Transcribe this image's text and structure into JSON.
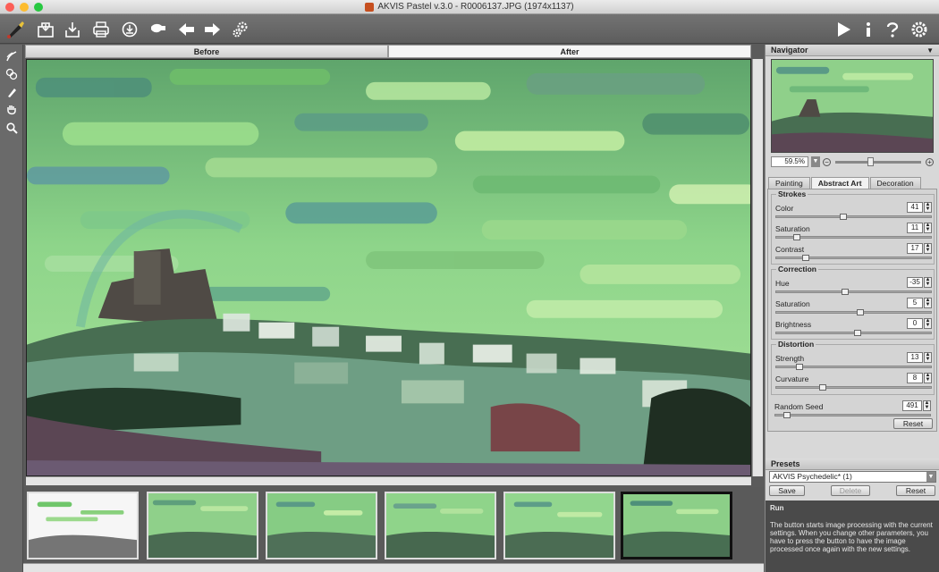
{
  "window": {
    "title": "AKVIS Pastel v.3.0 - R0006137.JPG (1974x1137)"
  },
  "toolbar": {
    "left_icons": [
      "brush-logo-icon",
      "open-icon",
      "save-icon",
      "print-icon",
      "share-icon",
      "plugin-icon",
      "undo-icon",
      "redo-icon",
      "gear-cogs-icon"
    ],
    "right_icons": [
      "run-icon",
      "info-icon",
      "help-icon",
      "settings-icon"
    ]
  },
  "view_tabs": {
    "before": "Before",
    "after": "After"
  },
  "navigator": {
    "title": "Navigator",
    "zoom": "59.5%"
  },
  "settings_tabs": [
    "Painting",
    "Abstract Art",
    "Decoration"
  ],
  "strokes": {
    "title": "Strokes",
    "params": [
      {
        "label": "Color",
        "value": "41",
        "level": 0.41
      },
      {
        "label": "Saturation",
        "value": "11",
        "level": 0.11
      },
      {
        "label": "Contrast",
        "value": "17",
        "level": 0.17
      }
    ]
  },
  "correction": {
    "title": "Correction",
    "params": [
      {
        "label": "Hue",
        "value": "-35",
        "level": 0.42
      },
      {
        "label": "Saturation",
        "value": "5",
        "level": 0.52
      },
      {
        "label": "Brightness",
        "value": "0",
        "level": 0.5
      }
    ]
  },
  "distortion": {
    "title": "Distortion",
    "params": [
      {
        "label": "Strength",
        "value": "13",
        "level": 0.13
      },
      {
        "label": "Curvature",
        "value": "8",
        "level": 0.28
      }
    ]
  },
  "random_seed": {
    "label": "Random Seed",
    "value": "491",
    "level": 0.05
  },
  "buttons": {
    "reset": "Reset",
    "save": "Save",
    "delete": "Delete",
    "preset_reset": "Reset"
  },
  "presets": {
    "title": "Presets",
    "selected": "AKVIS Psychedelic* (1)"
  },
  "help": {
    "title": "Run",
    "text": "The button starts image processing with the current settings. When you change other parameters, you have to press the button to have the image processed once again with the new settings."
  },
  "colors": {
    "accent_red": "#c0392b",
    "panel_bg": "#d8d8d8",
    "toolbar_bg": "#6a6a6a"
  }
}
